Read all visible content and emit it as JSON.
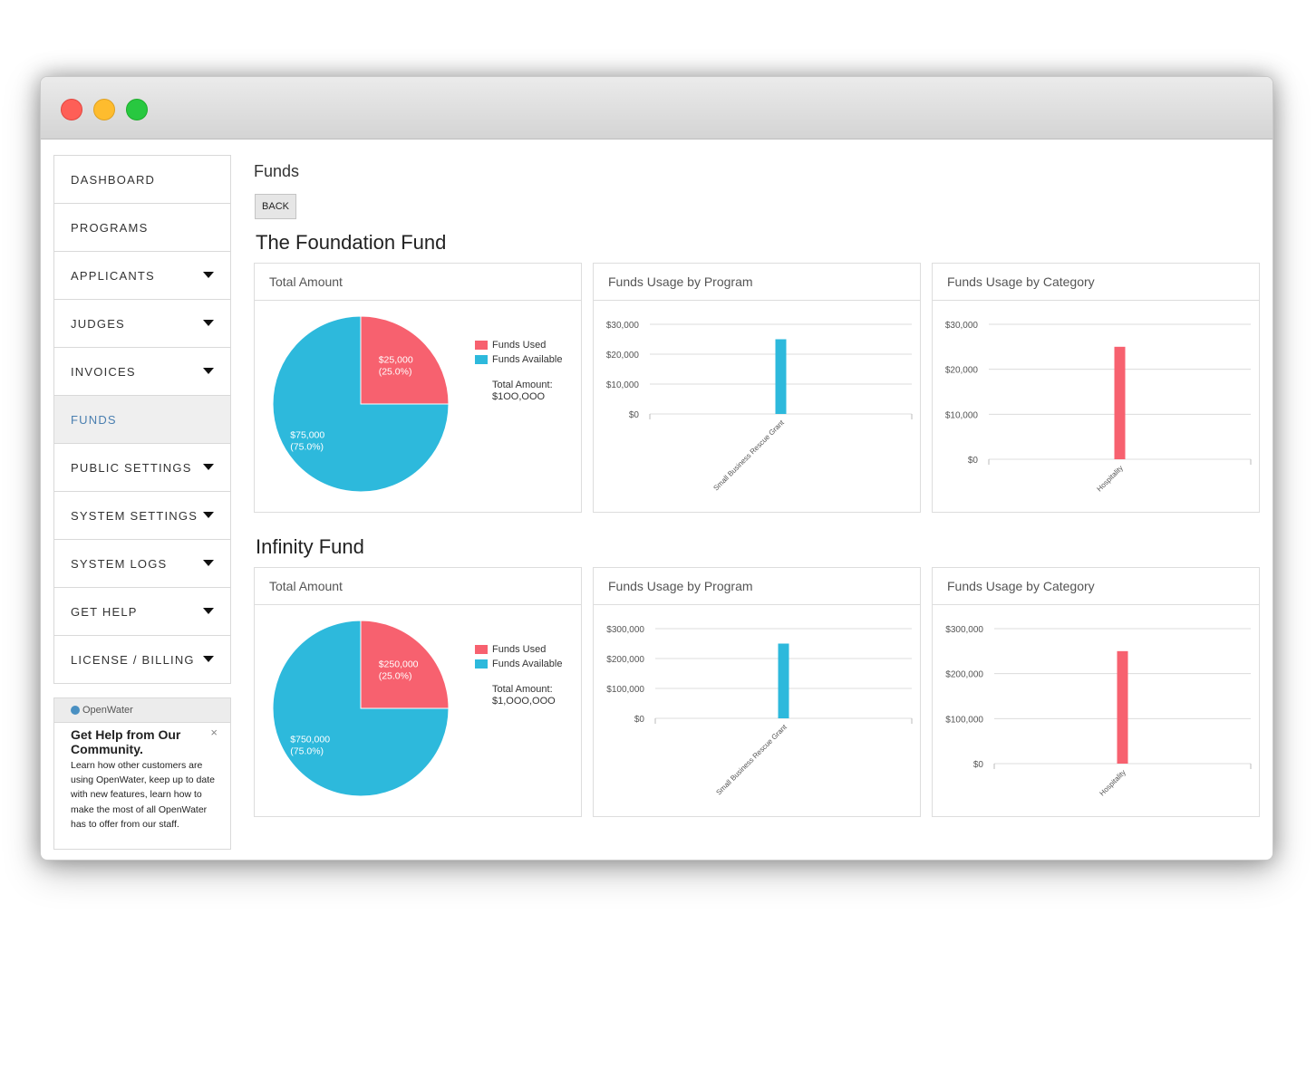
{
  "nav": {
    "items": [
      {
        "label": "DASHBOARD",
        "caret": false,
        "active": false
      },
      {
        "label": "PROGRAMS",
        "caret": false,
        "active": false
      },
      {
        "label": "APPLICANTS",
        "caret": true,
        "active": false
      },
      {
        "label": "JUDGES",
        "caret": true,
        "active": false
      },
      {
        "label": "INVOICES",
        "caret": true,
        "active": false
      },
      {
        "label": "FUNDS",
        "caret": false,
        "active": true
      },
      {
        "label": "PUBLIC SETTINGS",
        "caret": true,
        "active": false
      },
      {
        "label": "SYSTEM SETTINGS",
        "caret": true,
        "active": false
      },
      {
        "label": "SYSTEM LOGS",
        "caret": true,
        "active": false
      },
      {
        "label": "GET HELP",
        "caret": true,
        "active": false
      },
      {
        "label": "LICENSE / BILLING",
        "caret": true,
        "active": false
      }
    ]
  },
  "help": {
    "brand": "OpenWater",
    "title": "Get Help from Our Community.",
    "body": "Learn how other customers are using OpenWater, keep up to date with new features, learn how to make the most of all OpenWater has to offer from our staff.",
    "close": "×"
  },
  "page": {
    "title": "Funds",
    "back_label": "BACK"
  },
  "colors": {
    "used": "#f7616f",
    "available": "#2db9dc"
  },
  "funds": [
    {
      "name": "The Foundation Fund",
      "panels": {
        "total": "Total Amount",
        "program": "Funds Usage by Program",
        "category": "Funds Usage by Category"
      },
      "legend": {
        "used": "Funds Used",
        "available": "Funds Available",
        "total_label": "Total Amount:",
        "total_value": "$1OO,OOO"
      }
    },
    {
      "name": "Infinity Fund",
      "panels": {
        "total": "Total Amount",
        "program": "Funds Usage by Program",
        "category": "Funds Usage by Category"
      },
      "legend": {
        "used": "Funds Used",
        "available": "Funds Available",
        "total_label": "Total Amount:",
        "total_value": "$1,OOO,OOO"
      }
    }
  ],
  "chart_data": [
    {
      "type": "pie",
      "fund": "The Foundation Fund",
      "title": "Total Amount",
      "slices": [
        {
          "name": "Funds Used",
          "value": 25000,
          "label": "$25,000",
          "pct": "(25.0%)"
        },
        {
          "name": "Funds Available",
          "value": 75000,
          "label": "$75,000",
          "pct": "(75.0%)"
        }
      ]
    },
    {
      "type": "bar",
      "fund": "The Foundation Fund",
      "title": "Funds Usage by Program",
      "categories": [
        "Small Business Rescue Grant"
      ],
      "values": [
        25000
      ],
      "ylim": [
        0,
        30000
      ],
      "yticks": [
        "$30,000",
        "$20,000",
        "$10,000",
        "$0"
      ],
      "color": "available"
    },
    {
      "type": "bar",
      "fund": "The Foundation Fund",
      "title": "Funds Usage by Category",
      "categories": [
        "Hospitality"
      ],
      "values": [
        25000
      ],
      "ylim": [
        0,
        30000
      ],
      "yticks": [
        "$30,000",
        "$20,000",
        "$10,000",
        "$0"
      ],
      "color": "used"
    },
    {
      "type": "pie",
      "fund": "Infinity Fund",
      "title": "Total Amount",
      "slices": [
        {
          "name": "Funds Used",
          "value": 250000,
          "label": "$250,000",
          "pct": "(25.0%)"
        },
        {
          "name": "Funds Available",
          "value": 750000,
          "label": "$750,000",
          "pct": "(75.0%)"
        }
      ]
    },
    {
      "type": "bar",
      "fund": "Infinity Fund",
      "title": "Funds Usage by Program",
      "categories": [
        "Small Business Rescue Grant"
      ],
      "values": [
        250000
      ],
      "ylim": [
        0,
        300000
      ],
      "yticks": [
        "$300,000",
        "$200,000",
        "$100,000",
        "$0"
      ],
      "color": "available"
    },
    {
      "type": "bar",
      "fund": "Infinity Fund",
      "title": "Funds Usage by Category",
      "categories": [
        "Hospitality"
      ],
      "values": [
        250000
      ],
      "ylim": [
        0,
        300000
      ],
      "yticks": [
        "$300,000",
        "$200,000",
        "$100,000",
        "$0"
      ],
      "color": "used"
    }
  ]
}
